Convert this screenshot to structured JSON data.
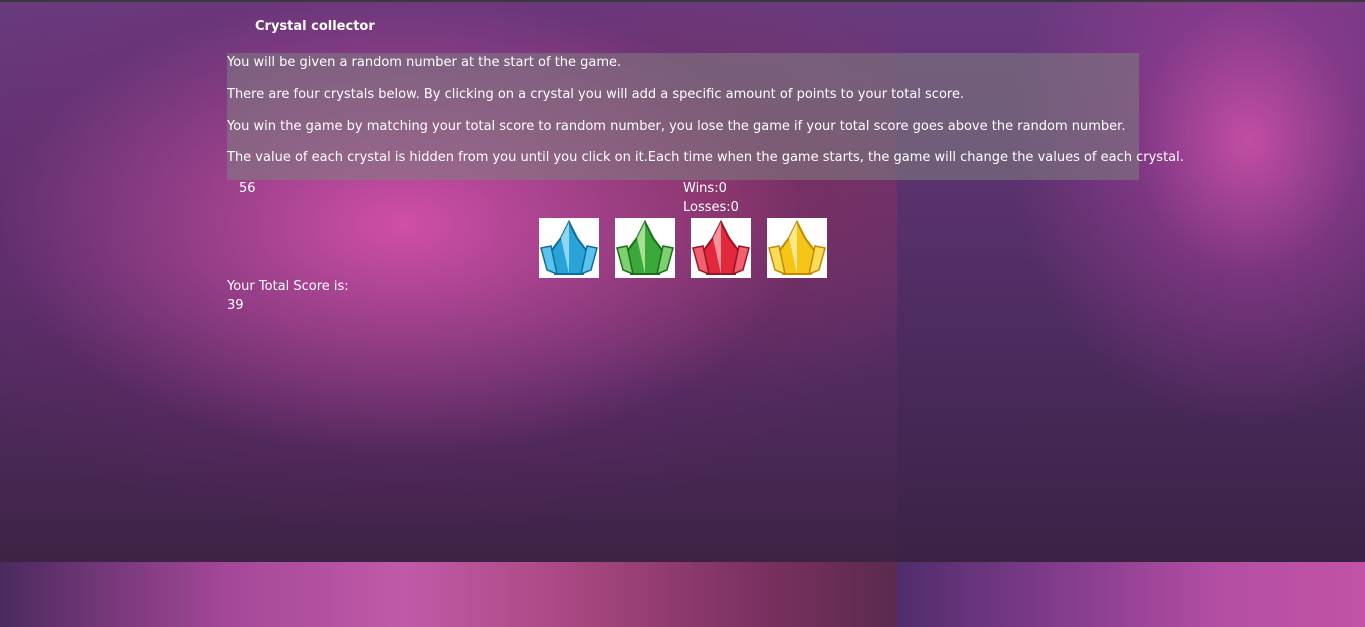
{
  "game": {
    "title": "Crystal collector",
    "instructions": [
      "You will be given a random number at the start of the game.",
      "There are four crystals below. By clicking on a crystal you will add a specific amount of points to your total score.",
      "You win the game by matching your total score to random number, you lose the game if your total score goes above the random number.",
      "The value of each crystal is hidden from you until you click on it.Each time when the game starts, the game will change the values of each crystal."
    ],
    "target_number": "56",
    "wins_text": "Wins:0",
    "losses_text": "Losses:0",
    "score_label": "Your Total Score is:",
    "score_value": "39"
  },
  "crystals": [
    {
      "icon": "blue-crystal-icon",
      "color": "#2aa3d8"
    },
    {
      "icon": "green-crystal-icon",
      "color": "#3aa83a"
    },
    {
      "icon": "red-crystal-icon",
      "color": "#e2283a"
    },
    {
      "icon": "yellow-crystal-icon",
      "color": "#f5c518"
    }
  ]
}
